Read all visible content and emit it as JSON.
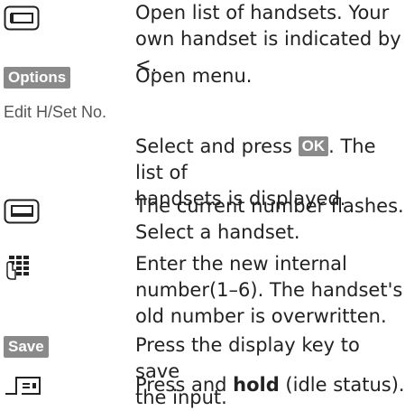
{
  "steps": [
    {
      "icon": "left-control-key-icon",
      "text_line1": "Open list of handsets. Your",
      "text_line2": "own handset is indicated by <."
    },
    {
      "key_label": "Options",
      "text": "Open menu."
    },
    {
      "heading": "Edit H/Set No.",
      "text_before": "Select and press ",
      "ok_label": "OK",
      "text_after": ". The list of",
      "text_line2": "handsets is displayed."
    },
    {
      "icon": "down-control-key-icon",
      "text_line1": "The current number flashes.",
      "text_line2": "Select a handset."
    },
    {
      "icon": "keypad-icon",
      "text_line1": "Enter the new internal",
      "text_line2": "number(1–6). The handset's",
      "text_line3": "old number is overwritten."
    },
    {
      "key_label": "Save",
      "text_line1": "Press the display key to save",
      "text_line2": "the input."
    },
    {
      "icon": "end-call-key-icon",
      "text_before": "Press and ",
      "bold": "hold",
      "text_after": " (idle status)."
    }
  ]
}
